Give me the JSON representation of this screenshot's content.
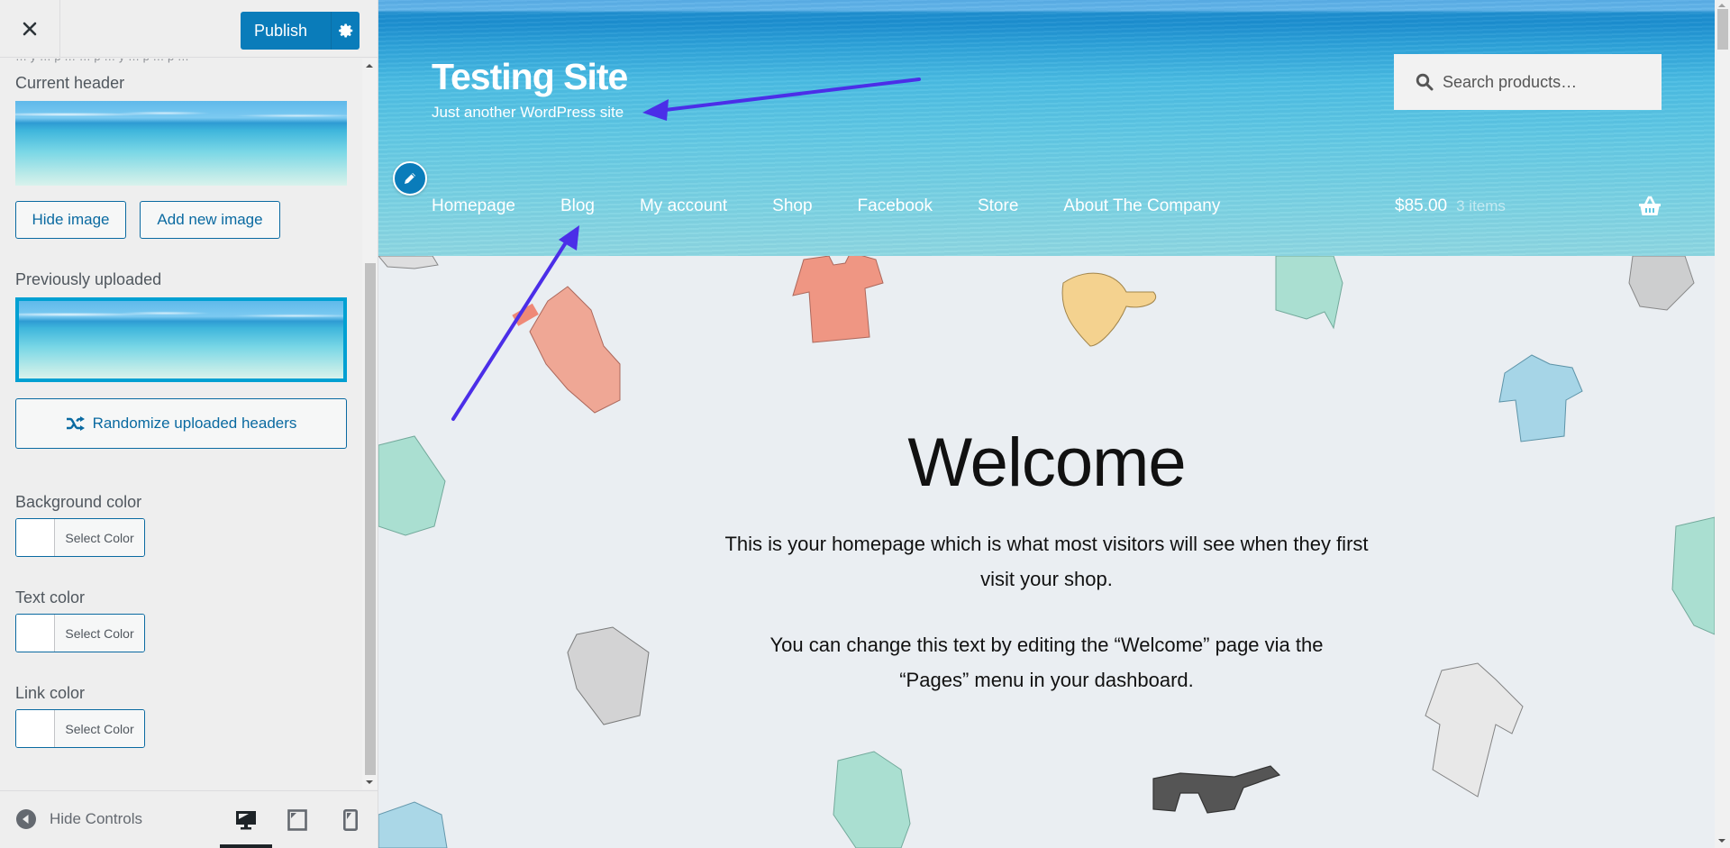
{
  "sidebar": {
    "close_label": "Close",
    "publish_label": "Publish",
    "cut_text": "… y … p … … p … y … p … p …",
    "current_header": {
      "label": "Current header",
      "hide_image": "Hide image",
      "add_new_image": "Add new image"
    },
    "previously_uploaded": {
      "label": "Previously uploaded",
      "randomize": "Randomize uploaded headers"
    },
    "colors": [
      {
        "label": "Background color",
        "button": "Select Color",
        "value": "#ffffff"
      },
      {
        "label": "Text color",
        "button": "Select Color",
        "value": "#ffffff"
      },
      {
        "label": "Link color",
        "button": "Select Color",
        "value": "#ffffff"
      }
    ],
    "footer": {
      "hide_controls": "Hide Controls",
      "devices": [
        "desktop",
        "tablet",
        "mobile"
      ],
      "active_device": "desktop"
    }
  },
  "preview": {
    "site_title": "Testing Site",
    "site_description": "Just another WordPress site",
    "search": {
      "placeholder": "Search products…",
      "value": ""
    },
    "nav": [
      "Homepage",
      "Blog",
      "My account",
      "Shop",
      "Facebook",
      "Store",
      "About The Company"
    ],
    "cart": {
      "total": "$85.00",
      "count": "3 items"
    },
    "welcome": {
      "title": "Welcome",
      "paragraph1": "This is your homepage which is what most visitors will see when they first visit your shop.",
      "paragraph2": "You can change this text by editing the “Welcome” page via the “Pages” menu in your dashboard."
    }
  },
  "colors": {
    "accent": "#0a7cba",
    "selected_border": "#00a0d2",
    "annotation_arrow": "#4b2ee8",
    "content_bg": "#eaeef2"
  }
}
